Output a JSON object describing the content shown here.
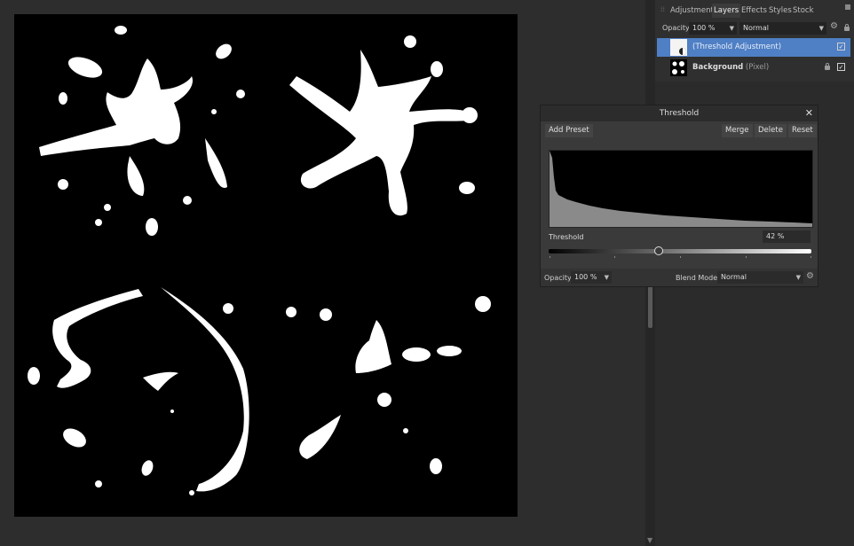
{
  "panel": {
    "tabs": [
      "Adjustment",
      "Layers",
      "Effects",
      "Styles",
      "Stock"
    ],
    "active_tab": "Layers",
    "opacity_label": "Opacity:",
    "opacity_value": "100 %",
    "blend_mode": "Normal",
    "layers": [
      {
        "name": "(Threshold Adjustment)",
        "type": "",
        "selected": true,
        "visible": true
      },
      {
        "name": "Background",
        "type": "(Pixel)",
        "selected": false,
        "visible": true
      }
    ]
  },
  "dialog": {
    "title": "Threshold",
    "add_preset": "Add Preset",
    "merge": "Merge",
    "delete": "Delete",
    "reset": "Reset",
    "threshold_label": "Threshold",
    "threshold_value": "42 %",
    "threshold_fraction": 0.42,
    "opacity_label": "Opacity:",
    "opacity_value": "100 %",
    "blend_label": "Blend Mode:",
    "blend_value": "Normal"
  },
  "colors": {
    "selection": "#4f7fc4",
    "canvas": "#000000",
    "ink": "#ffffff"
  }
}
